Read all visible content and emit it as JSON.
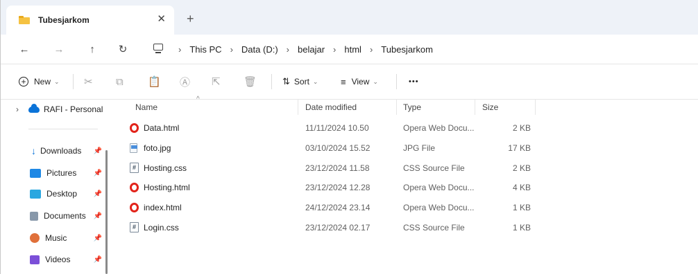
{
  "tab": {
    "title": "Tubesjarkom",
    "close": "✕",
    "new_tab": "+"
  },
  "nav": {
    "back": "←",
    "forward": "→",
    "up": "↑",
    "refresh": "↻",
    "breadcrumb": [
      "This PC",
      "Data (D:)",
      "belajar",
      "html",
      "Tubesjarkom"
    ],
    "separator": "›"
  },
  "toolbar": {
    "new_label": "New",
    "sort_label": "Sort",
    "view_label": "View",
    "more_label": "•••"
  },
  "sidebar": {
    "onedrive": "RAFI - Personal",
    "items": [
      {
        "label": "Downloads",
        "icon": "download-icon"
      },
      {
        "label": "Pictures",
        "icon": "pictures-icon"
      },
      {
        "label": "Desktop",
        "icon": "desktop-icon"
      },
      {
        "label": "Documents",
        "icon": "documents-icon"
      },
      {
        "label": "Music",
        "icon": "music-icon"
      },
      {
        "label": "Videos",
        "icon": "videos-icon"
      }
    ]
  },
  "columns": {
    "name": "Name",
    "date": "Date modified",
    "type": "Type",
    "size": "Size"
  },
  "files": [
    {
      "name": "Data.html",
      "date": "11/11/2024 10.50",
      "type": "Opera Web Docu...",
      "size": "2 KB",
      "icon": "opera-icon"
    },
    {
      "name": "foto.jpg",
      "date": "03/10/2024 15.52",
      "type": "JPG File",
      "size": "17 KB",
      "icon": "image-file-icon"
    },
    {
      "name": "Hosting.css",
      "date": "23/12/2024 11.58",
      "type": "CSS Source File",
      "size": "2 KB",
      "icon": "css-file-icon"
    },
    {
      "name": "Hosting.html",
      "date": "23/12/2024 12.28",
      "type": "Opera Web Docu...",
      "size": "4 KB",
      "icon": "opera-icon"
    },
    {
      "name": "index.html",
      "date": "24/12/2024 23.14",
      "type": "Opera Web Docu...",
      "size": "1 KB",
      "icon": "opera-icon"
    },
    {
      "name": "Login.css",
      "date": "23/12/2024 02.17",
      "type": "CSS Source File",
      "size": "1 KB",
      "icon": "css-file-icon"
    }
  ],
  "colors": {
    "accent": "#0b73d8",
    "opera": "#e2231a",
    "folder": "#f5c242",
    "tabbar": "#eef2f8"
  }
}
